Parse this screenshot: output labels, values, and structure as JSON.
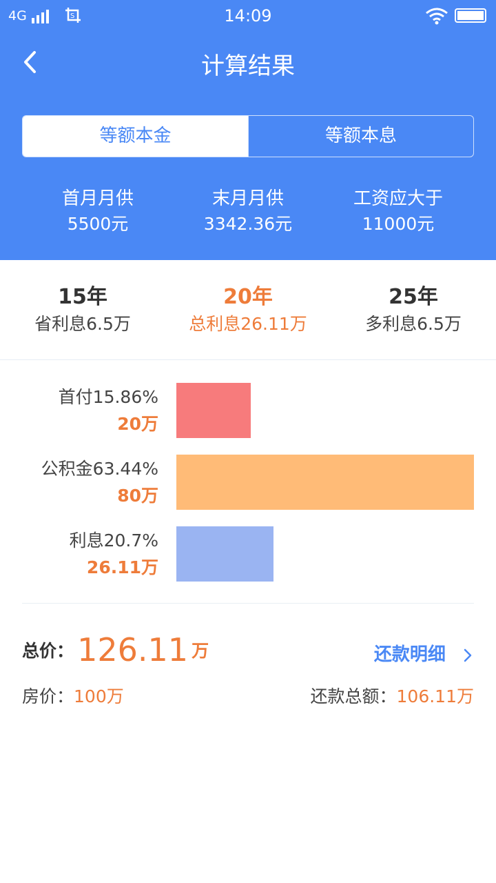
{
  "status_bar": {
    "network": "4G",
    "time": "14:09"
  },
  "header": {
    "title": "计算结果"
  },
  "tabs": [
    {
      "label": "等额本金",
      "active": true
    },
    {
      "label": "等额本息",
      "active": false
    }
  ],
  "summary": [
    {
      "label": "首月月供",
      "value": "5500元"
    },
    {
      "label": "末月月供",
      "value": "3342.36元"
    },
    {
      "label": "工资应大于",
      "value": "11000元"
    }
  ],
  "years": [
    {
      "year": "15年",
      "desc": "省利息6.5万",
      "active": false
    },
    {
      "year": "20年",
      "desc": "总利息26.11万",
      "active": true
    },
    {
      "year": "25年",
      "desc": "多利息6.5万",
      "active": false
    }
  ],
  "breakdown": [
    {
      "name": "首付15.86%",
      "amount": "20万",
      "value": 20,
      "color": "#f77b7c"
    },
    {
      "name": "公积金63.44%",
      "amount": "80万",
      "value": 80,
      "color": "#ffbb77"
    },
    {
      "name": "利息20.7%",
      "amount": "26.11万",
      "value": 26.11,
      "color": "#9ab4f2"
    }
  ],
  "total": {
    "label": "总价：",
    "value": "126.11",
    "unit": "万"
  },
  "detail_link": "还款明细",
  "house_price": {
    "label": "房价：",
    "value": "100万"
  },
  "repay_total": {
    "label": "还款总额：",
    "value": "106.11万"
  },
  "colors": {
    "primary": "#4a88f5",
    "accent": "#ee7c3a"
  }
}
